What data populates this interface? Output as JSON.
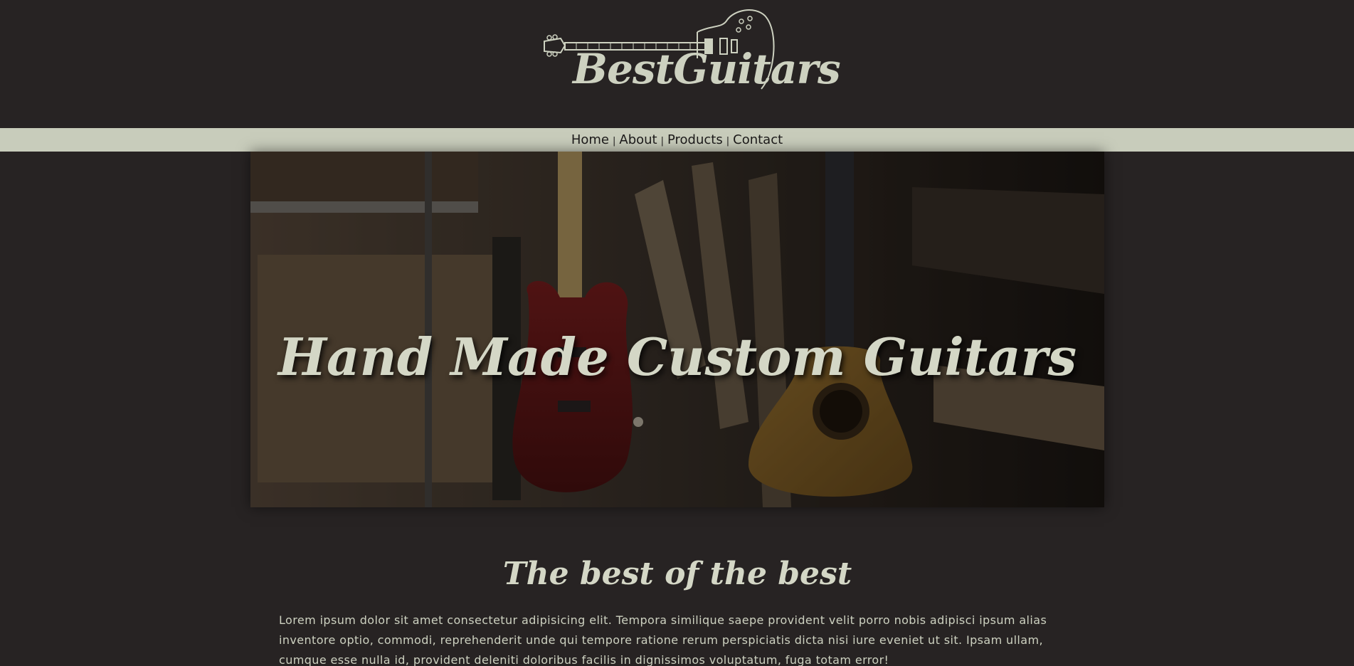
{
  "brand": {
    "name": "BestGuitars",
    "text_color": "#cdd1c0"
  },
  "nav": {
    "items": [
      {
        "label": "Home"
      },
      {
        "label": "About"
      },
      {
        "label": "Products"
      },
      {
        "label": "Contact"
      }
    ],
    "separator": "|",
    "background": "#c8ccbb"
  },
  "hero": {
    "title": "Hand Made Custom Guitars",
    "image_icon": "guitars-workshop-photo"
  },
  "section": {
    "title": "The best of the best",
    "paragraph": "Lorem ipsum dolor sit amet consectetur adipisicing elit. Tempora similique saepe provident velit porro nobis adipisci ipsum alias inventore optio, commodi, reprehenderit unde qui tempore ratione rerum perspiciatis dicta nisi iure eveniet ut sit. Ipsam ullam, cumque esse nulla id, provident deleniti doloribus facilis in dignissimos voluptatum, fuga totam error!"
  },
  "colors": {
    "page_background": "#272323",
    "accent_text": "#d4d7c6"
  }
}
